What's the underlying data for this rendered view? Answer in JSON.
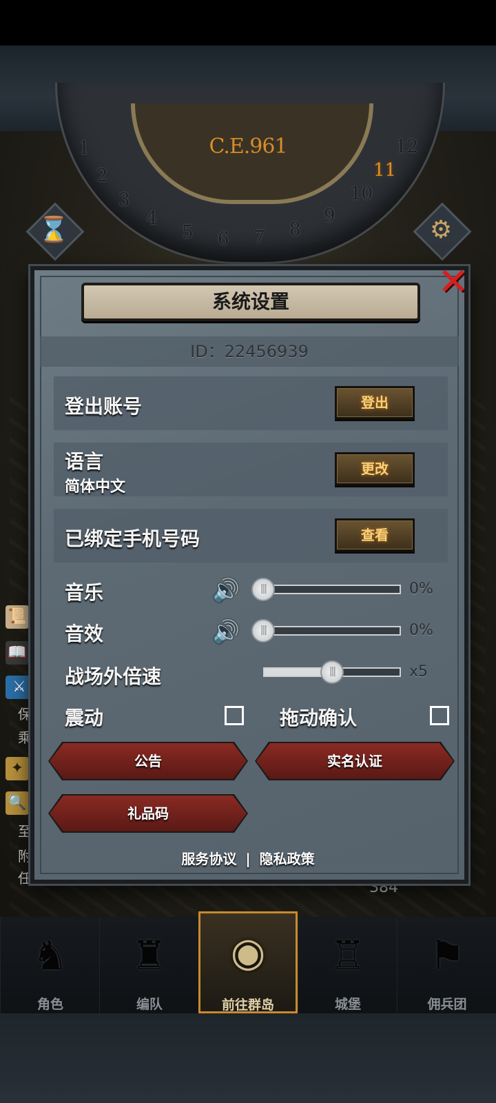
{
  "calendar": {
    "year": "C.E.961",
    "numbers": [
      "1",
      "2",
      "3",
      "4",
      "5",
      "6",
      "7",
      "8",
      "9",
      "10",
      "11",
      "12"
    ],
    "current_month": "11"
  },
  "icons": {
    "hourglass": "hourglass-icon",
    "settings": "gear-icon",
    "close": "close-icon",
    "speaker": "speaker-icon"
  },
  "colors": {
    "accent_gold": "#f7d27a",
    "close_red": "#d4201f",
    "active_tab_border": "#c98a2e"
  },
  "dialog": {
    "title": "系统设置",
    "id_text": "ID：22456939",
    "rows": {
      "logout": {
        "label": "登出账号",
        "button": "登出"
      },
      "language": {
        "label": "语言",
        "value": "简体中文",
        "button": "更改"
      },
      "phone": {
        "label": "已绑定手机号码",
        "button": "查看"
      }
    },
    "music": {
      "label": "音乐",
      "value_text": "0%",
      "level": 0.0
    },
    "sfx": {
      "label": "音效",
      "value_text": "0%",
      "level": 0.0
    },
    "speed": {
      "label": "战场外倍速",
      "value_text": "x5",
      "level": 0.5
    },
    "vibration": {
      "label": "震动",
      "checked": false
    },
    "drag_confirm": {
      "label": "拖动确认",
      "checked": false
    },
    "buttons": {
      "notice": "公告",
      "realname": "实名认证",
      "gift_code": "礼品码"
    },
    "footer": {
      "service": "服务协议",
      "separator": "|",
      "privacy": "隐私政策"
    }
  },
  "side": {
    "text1": "保",
    "text2": "乘",
    "text3": "至",
    "text4": "附",
    "text5": "任"
  },
  "resource": {
    "count": "384"
  },
  "bottom_nav": [
    {
      "label": "角色",
      "icon": "knight-icon"
    },
    {
      "label": "编队",
      "icon": "party-icon"
    },
    {
      "label": "前往群岛",
      "icon": "globe-icon",
      "active": true
    },
    {
      "label": "城堡",
      "icon": "castle-icon"
    },
    {
      "label": "佣兵团",
      "icon": "banner-icon"
    }
  ]
}
